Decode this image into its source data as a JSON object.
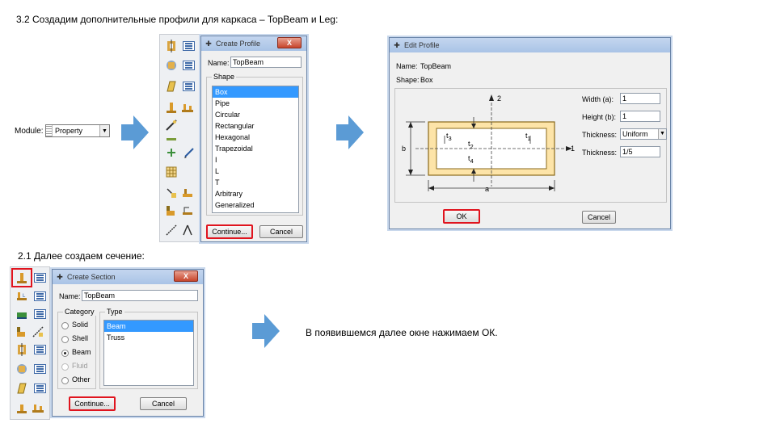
{
  "captions": {
    "step_3_2": "3.2 Создадим дополнительные профили для каркаса – TopBeam и Leg:",
    "step_2_1": "2.1 Далее создаем сечение:",
    "final_note": "В появившемся далее окне нажимаем ОК."
  },
  "module_selector": {
    "label": "Module:",
    "value": "Property",
    "dropdown_glyph": "▼"
  },
  "create_profile_dialog": {
    "title": "Create Profile",
    "close_label": "X",
    "name_label": "Name:",
    "name_value": "TopBeam",
    "shape_label": "Shape",
    "shapes": [
      "Box",
      "Pipe",
      "Circular",
      "Rectangular",
      "Hexagonal",
      "Trapezoidal",
      "I",
      "L",
      "T",
      "Arbitrary",
      "Generalized"
    ],
    "selected_shape": "Box",
    "continue_label": "Continue...",
    "cancel_label": "Cancel"
  },
  "edit_profile_dialog": {
    "title": "Edit Profile",
    "name_label": "Name:",
    "name_value": "TopBeam",
    "shape_label": "Shape:",
    "shape_value": "Box",
    "width_label": "Width (a):",
    "width_value": "1",
    "height_label": "Height (b):",
    "height_value": "1",
    "thickness_mode_label": "Thickness:",
    "thickness_mode_value": "Uniform",
    "thickness_label": "Thickness:",
    "thickness_value": "1/5",
    "ok_label": "OK",
    "cancel_label": "Cancel",
    "diagram": {
      "axis_2": "2",
      "axis_1": "1",
      "dim_a": "a",
      "dim_b": "b",
      "t1_a": "t",
      "t1_a_sub": "3",
      "t2": "t",
      "t2_sub": "2",
      "t1_b": "t",
      "t1_b_sub": "1",
      "t4": "t",
      "t4_sub": "4"
    }
  },
  "create_section_dialog": {
    "title": "Create Section",
    "close_label": "X",
    "name_label": "Name:",
    "name_value": "TopBeam",
    "category_label": "Category",
    "type_label": "Type",
    "categories": [
      {
        "label": "Solid",
        "selected": false,
        "enabled": true
      },
      {
        "label": "Shell",
        "selected": false,
        "enabled": true
      },
      {
        "label": "Beam",
        "selected": true,
        "enabled": true
      },
      {
        "label": "Fluid",
        "selected": false,
        "enabled": false
      },
      {
        "label": "Other",
        "selected": false,
        "enabled": true
      }
    ],
    "types": [
      "Beam",
      "Truss"
    ],
    "selected_type": "Beam",
    "continue_label": "Continue...",
    "cancel_label": "Cancel"
  },
  "colors": {
    "arrow_blue": "#5b9bd5",
    "highlight_red": "#e0141e",
    "selection_blue": "#3399ff",
    "profile_fill": "#fde4a8",
    "profile_stroke": "#b8860b"
  }
}
